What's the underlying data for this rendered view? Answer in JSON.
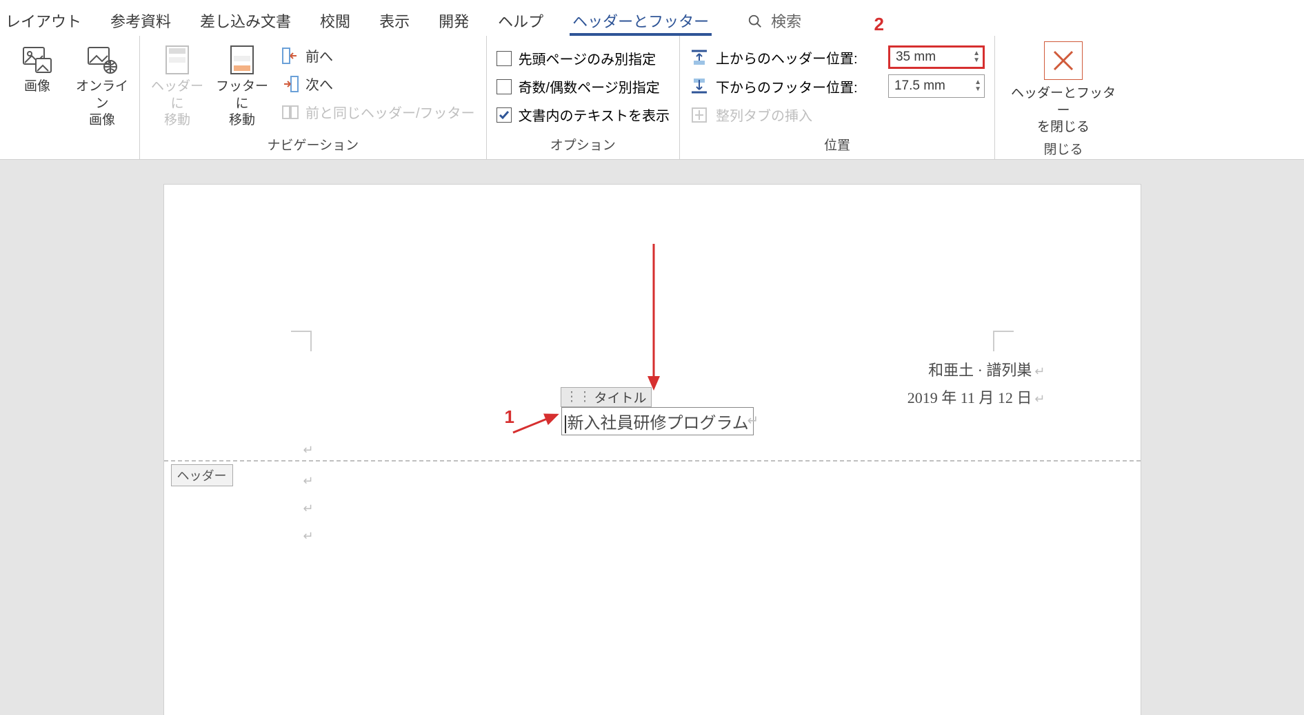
{
  "menubar": {
    "tabs": [
      "レイアウト",
      "参考資料",
      "差し込み文書",
      "校閲",
      "表示",
      "開発",
      "ヘルプ",
      "ヘッダーとフッター"
    ],
    "active_tab": "ヘッダーとフッター",
    "search_label": "検索"
  },
  "ribbon": {
    "groups": {
      "illustrations": {
        "image": "画像",
        "online_image": "オンライン\n画像"
      },
      "navigation": {
        "label": "ナビゲーション",
        "goto_header": "ヘッダーに\n移動",
        "goto_footer": "フッターに\n移動",
        "prev": "前へ",
        "next": "次へ",
        "link_prev": "前と同じヘッダー/フッター"
      },
      "options": {
        "label": "オプション",
        "first_page": "先頭ページのみ別指定",
        "odd_even": "奇数/偶数ページ別指定",
        "show_doc_text": "文書内のテキストを表示"
      },
      "position": {
        "label": "位置",
        "header_top": "上からのヘッダー位置:",
        "footer_bottom": "下からのフッター位置:",
        "header_top_value": "35 mm",
        "footer_bottom_value": "17.5 mm",
        "align_tab": "整列タブの挿入"
      },
      "close": {
        "label": "閉じる",
        "close_btn": "ヘッダーとフッター\nを閉じる"
      }
    }
  },
  "annotations": {
    "num1": "1",
    "num2": "2"
  },
  "document": {
    "header_badge": "ヘッダー",
    "title_label": "タイトル",
    "title_text": "新入社員研修プログラム",
    "right_name": "和亜土 · 譜列巣",
    "right_date": "2019 年 11 月 12 日"
  }
}
